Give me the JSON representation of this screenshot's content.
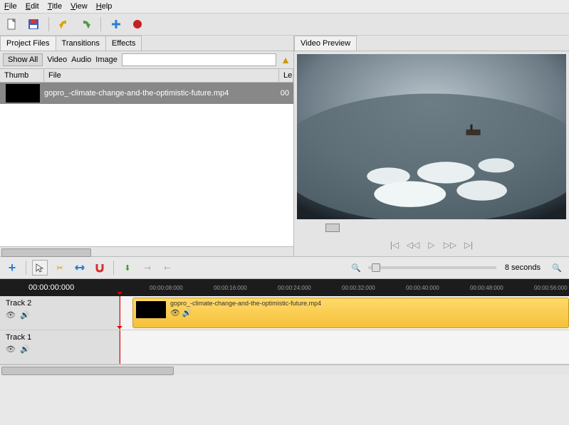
{
  "menu": {
    "file": "File",
    "edit": "Edit",
    "title": "Title",
    "view": "View",
    "help": "Help"
  },
  "tabs": {
    "project_files": "Project Files",
    "transitions": "Transitions",
    "effects": "Effects",
    "video_preview": "Video Preview"
  },
  "filters": {
    "show_all": "Show All",
    "video": "Video",
    "audio": "Audio",
    "image": "Image"
  },
  "columns": {
    "thumb": "Thumb",
    "file": "File",
    "len": "Le"
  },
  "file_row": {
    "name": "gopro_-climate-change-and-the-optimistic-future.mp4",
    "len": "00"
  },
  "timeline": {
    "zoom_label": "8 seconds",
    "current_time": "00:00:00:000",
    "ticks": [
      "00:00:08:000",
      "00:00:16:000",
      "00:00:24:000",
      "00:00:32:000",
      "00:00:40:000",
      "00:00:48:000",
      "00:00:56:000"
    ]
  },
  "tracks": {
    "t2": {
      "label": "Track 2"
    },
    "t1": {
      "label": "Track 1"
    }
  },
  "clip": {
    "name": "gopro_-climate-change-and-the-optimistic-future.mp4"
  }
}
